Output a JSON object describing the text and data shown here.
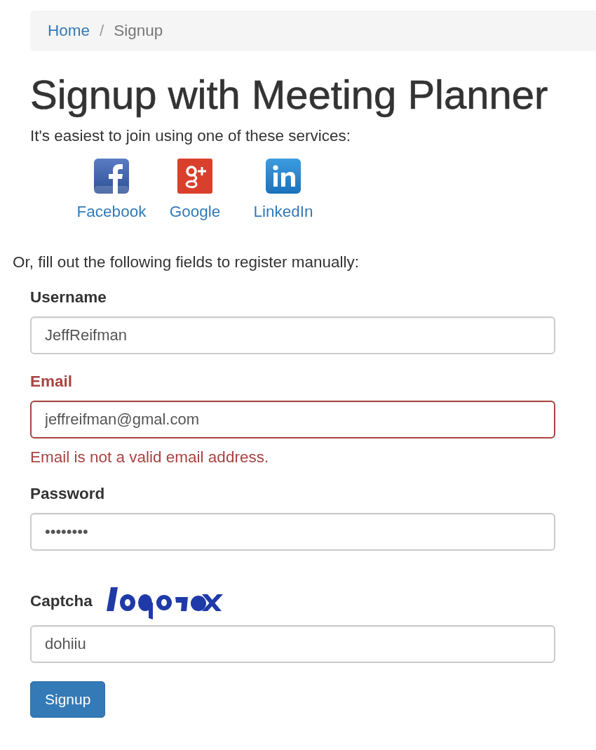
{
  "breadcrumb_separator": "/",
  "breadcrumb": [
    {
      "label": "Home",
      "kind": "link"
    },
    {
      "label": "Signup",
      "kind": "current"
    }
  ],
  "title": "Signup with Meeting Planner",
  "services_intro": "It's easiest to join using one of these services:",
  "services": [
    {
      "label": "Facebook",
      "kind": "facebook"
    },
    {
      "label": "Google",
      "kind": "google"
    },
    {
      "label": "LinkedIn",
      "kind": "linkedin"
    }
  ],
  "manual_intro": "Or, fill out the following fields to register manually:",
  "fields": [
    {
      "label": "Username",
      "value": "JeffReifman",
      "kind": "text",
      "has_error": false
    },
    {
      "label": "Email",
      "value": "jeffreifman@gmal.com",
      "kind": "text",
      "has_error": true,
      "error": "Email is not a valid email address."
    },
    {
      "label": "Password",
      "value": "••••••••",
      "kind": "password",
      "has_error": false
    },
    {
      "label": "Captcha",
      "value": "dohiiu",
      "kind": "captcha",
      "has_error": false
    }
  ],
  "submit": "Signup"
}
